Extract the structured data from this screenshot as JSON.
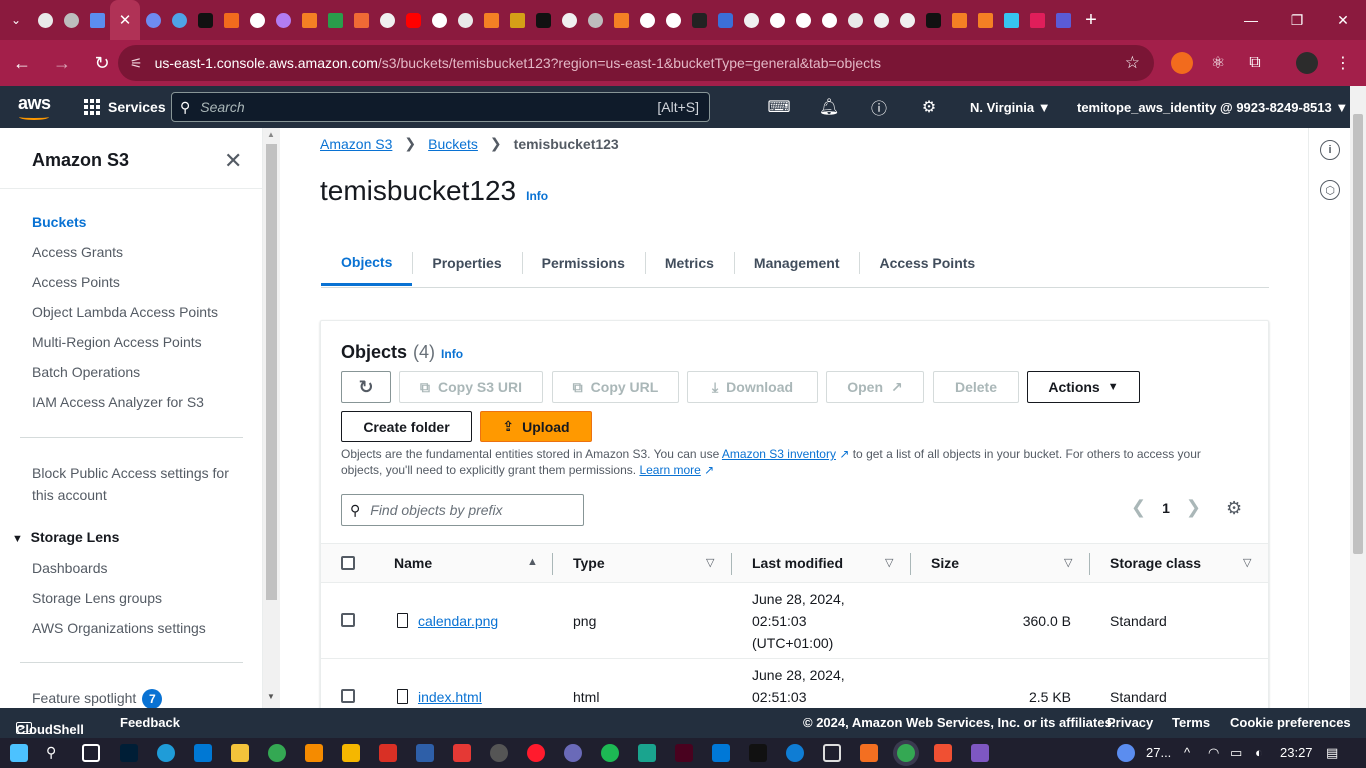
{
  "browser": {
    "tab_close": "✕",
    "new_tab": "+",
    "address": {
      "host": "us-east-1.console.aws.amazon.com",
      "path": "/s3/buckets/temisbucket123?region=us-east-1&bucketType=general&tab=objects"
    }
  },
  "aws_nav": {
    "logo": "aws",
    "services": "Services",
    "search_placeholder": "Search",
    "search_shortcut": "[Alt+S]",
    "region": "N. Virginia",
    "identity": "temitope_aws_identity @ 9923-8249-8513"
  },
  "sidebar": {
    "title": "Amazon S3",
    "items": [
      {
        "label": "Buckets",
        "active": true
      },
      {
        "label": "Access Grants"
      },
      {
        "label": "Access Points"
      },
      {
        "label": "Object Lambda Access Points"
      },
      {
        "label": "Multi-Region Access Points"
      },
      {
        "label": "Batch Operations"
      },
      {
        "label": "IAM Access Analyzer for S3"
      }
    ],
    "block_public_line1": "Block Public Access settings for",
    "block_public_line2": "this account",
    "storage_lens": {
      "title": "Storage Lens",
      "items": [
        "Dashboards",
        "Storage Lens groups",
        "AWS Organizations settings"
      ]
    },
    "feature_spotlight": "Feature spotlight",
    "feature_spotlight_count": "7"
  },
  "breadcrumb": {
    "root": "Amazon S3",
    "buckets": "Buckets",
    "current": "temisbucket123"
  },
  "page_title": "temisbucket123",
  "info_label": "Info",
  "tabs": [
    "Objects",
    "Properties",
    "Permissions",
    "Metrics",
    "Management",
    "Access Points"
  ],
  "objects_panel": {
    "title": "Objects",
    "count": "(4)",
    "buttons": {
      "copy_s3_uri": "Copy S3 URI",
      "copy_url": "Copy URL",
      "download": "Download",
      "open": "Open",
      "delete": "Delete",
      "actions": "Actions",
      "create_folder": "Create folder",
      "upload": "Upload"
    },
    "description_part1": "Objects are the fundamental entities stored in Amazon S3. You can use ",
    "inventory_link": "Amazon S3 inventory",
    "description_part2": " to get a list of all objects in your bucket. For others to access your objects, you'll need to explicitly grant them permissions. ",
    "learn_more": "Learn more",
    "find_placeholder": "Find objects by prefix",
    "page_number": "1",
    "columns": [
      "Name",
      "Type",
      "Last modified",
      "Size",
      "Storage class"
    ],
    "rows": [
      {
        "name": "calendar.png",
        "type": "png",
        "modified_1": "June 28, 2024,",
        "modified_2": "02:51:03",
        "modified_3": "(UTC+01:00)",
        "size": "360.0 B",
        "storage_class": "Standard"
      },
      {
        "name": "index.html",
        "type": "html",
        "modified_1": "June 28, 2024,",
        "modified_2": "02:51:03",
        "modified_3": "",
        "size": "2.5 KB",
        "storage_class": "Standard"
      }
    ]
  },
  "footer": {
    "cloudshell": "CloudShell",
    "feedback": "Feedback",
    "copyright": "© 2024, Amazon Web Services, Inc. or its affiliates.",
    "privacy": "Privacy",
    "terms": "Terms",
    "cookie": "Cookie preferences"
  },
  "taskbar": {
    "weather": "27...",
    "time": "23:27"
  },
  "colors": {
    "tab_strip": "#8b1a3e",
    "aws_nav": "#232f3e",
    "link": "#0972d3",
    "upload": "#ff9900"
  }
}
